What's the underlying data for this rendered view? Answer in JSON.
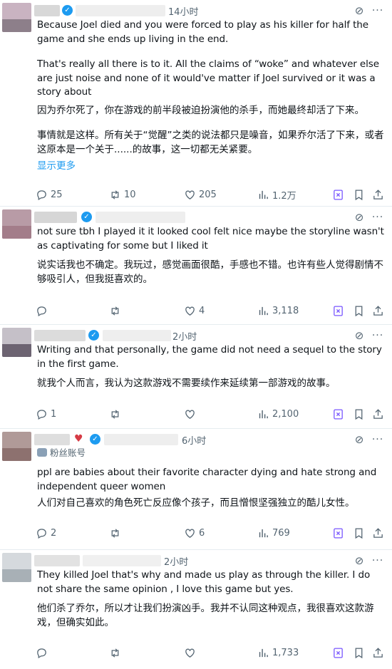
{
  "posts": [
    {
      "time": "14小时",
      "en": [
        "Because Joel died and you were forced to play as his killer for half the game and she ends up living in the end.",
        "That's really all there is to it. All the claims of “woke” and whatever else are just noise and none of it would've matter if Joel survived or it was a story about"
      ],
      "zh": [
        "因为乔尔死了，你在游戏的前半段被迫扮演他的杀手，而她最终却活了下来。",
        "事情就是这样。所有关于“觉醒”之类的说法都只是噪音，如果乔尔活了下来，或者这原本是一个关于......的故事，这一切都无关紧要。"
      ],
      "show_more": "显示更多",
      "replies": "25",
      "reposts": "10",
      "likes": "205",
      "views": "1.2万"
    },
    {
      "time": "",
      "en": [
        "not sure tbh I played it it looked cool felt nice maybe the storyline wasn't as captivating for some but I liked it"
      ],
      "zh": [
        "说实话我也不确定。我玩过，感觉画面很酷，手感也不错。也许有些人觉得剧情不够吸引人，但我挺喜欢的。"
      ],
      "replies": "",
      "reposts": "",
      "likes": "4",
      "views": "3,118"
    },
    {
      "time": "2小时",
      "en": [
        "Writing and that personally, the game did not need a sequel to the story in the first game."
      ],
      "zh": [
        "就我个人而言，我认为这款游戏不需要续作来延续第一部游戏的故事。"
      ],
      "replies": "1",
      "reposts": "",
      "likes": "",
      "views": "2,100"
    },
    {
      "time": "6小时",
      "badge": "粉丝账号",
      "en": [
        "ppl are babies about their favorite character dying and hate strong and independent queer women"
      ],
      "zh": [
        "人们对自己喜欢的角色死亡反应像个孩子，而且憎恨坚强独立的酷儿女性。"
      ],
      "replies": "2",
      "reposts": "",
      "likes": "6",
      "views": "769"
    },
    {
      "time": "2小时",
      "en": [
        "They killed Joel that's why and made us play as through the killer. I do not share the same opinion , I love this game but yes."
      ],
      "zh": [
        "他们杀了乔尔，所以才让我们扮演凶手。我并不认同这种观点，我很喜欢这款游戏，但确实如此。"
      ],
      "replies": "",
      "reposts": "",
      "likes": "",
      "views": "1,733"
    }
  ]
}
